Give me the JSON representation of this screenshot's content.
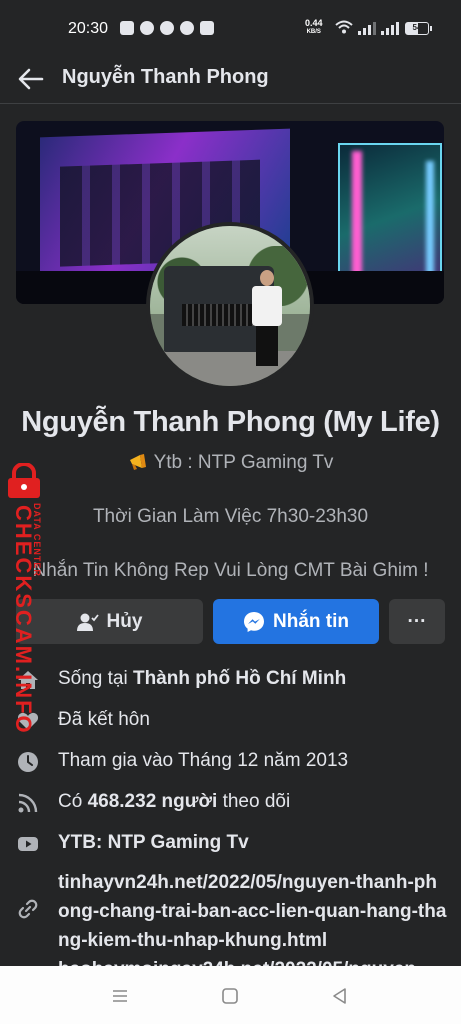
{
  "status_bar": {
    "time": "20:30",
    "net_speed": "0.44",
    "net_unit": "KB/S",
    "battery": "54"
  },
  "header": {
    "title": "Nguyễn Thanh Phong"
  },
  "profile": {
    "name": "Nguyễn Thanh Phong (My Life)",
    "bio": "Ytb : NTP Gaming Tv",
    "work_hours": "Thời Gian Làm Việc 7h30-23h30",
    "notice": "Nhắn Tin Không Rep Vui Lòng CMT Bài Ghim !"
  },
  "actions": {
    "cancel_label": "Hủy",
    "message_label": "Nhắn tin",
    "more_label": "···"
  },
  "details": {
    "lives_prefix": "Sống tại ",
    "lives_city": "Thành phố Hồ Chí Minh",
    "relationship": "Đã kết hôn",
    "joined": "Tham gia vào Tháng 12 năm 2013",
    "followers_prefix": "Có ",
    "followers_count": "468.232 người",
    "followers_suffix": " theo dõi",
    "youtube": "YTB: NTP Gaming Tv",
    "link_1": "tinhayvn24h.net/2022/05/nguyen-thanh-phong-chang-trai-ban-acc-lien-quan-hang-thang-kiem-thu-nhap-khung.html",
    "link_2": "baohaymoingay24h.net/2022/05/nguyen"
  },
  "watermark": {
    "brand": "CHECKSCAM.INFO",
    "sub": "DATA CENTER"
  },
  "icons": {
    "back": "back-arrow-icon",
    "home": "home-icon",
    "heart": "heart-icon",
    "clock": "clock-icon",
    "rss": "rss-icon",
    "youtube": "youtube-icon",
    "link": "link-icon",
    "messenger": "messenger-icon",
    "user_check": "user-check-icon"
  },
  "colors": {
    "background": "#242526",
    "primary_button": "#2374e1",
    "secondary_button": "#3a3b3c",
    "watermark": "#e02020"
  }
}
